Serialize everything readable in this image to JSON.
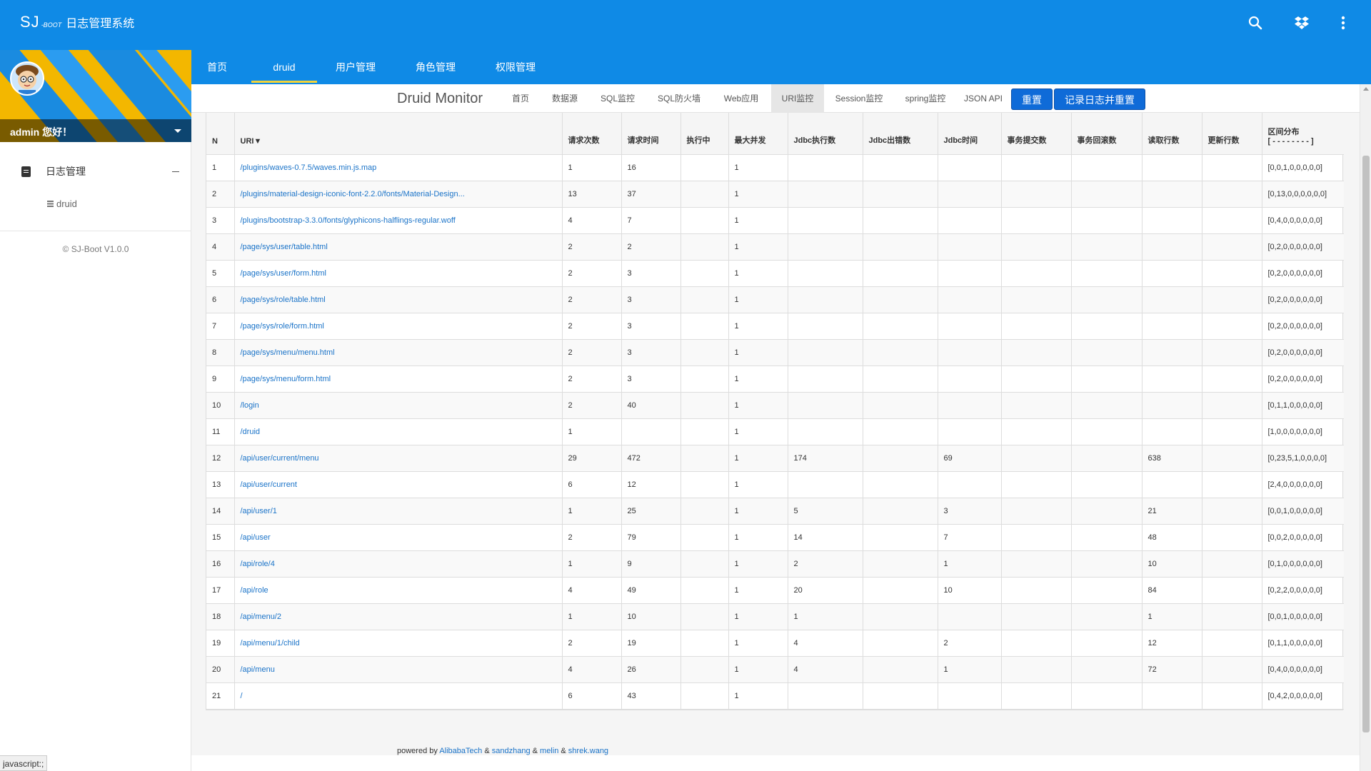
{
  "app": {
    "logo_sj": "SJ",
    "logo_boot": "-BOOT",
    "title": "日志管理系统"
  },
  "top_icons": [
    "search-icon",
    "dropbox-icon",
    "more-vert-icon"
  ],
  "sidebar": {
    "user_greeting": "admin 您好！",
    "menu_group": "日志管理",
    "menu_sub": "druid",
    "copyright": "© SJ-Boot V1.0.0"
  },
  "nav": {
    "tabs": [
      "首页",
      "druid",
      "用户管理",
      "角色管理",
      "权限管理"
    ],
    "active": "druid"
  },
  "druid": {
    "brand": "Druid Monitor",
    "tabs": [
      "首页",
      "数据源",
      "SQL监控",
      "SQL防火墙",
      "Web应用",
      "URI监控",
      "Session监控",
      "spring监控",
      "JSON API"
    ],
    "active_tab": "URI监控",
    "reset_button": "重置",
    "log_reset_button": "记录日志并重置"
  },
  "table": {
    "headers": [
      "N",
      "URI▼",
      "请求次数",
      "请求时间",
      "执行中",
      "最大并发",
      "Jdbc执行数",
      "Jdbc出错数",
      "Jdbc时间",
      "事务提交数",
      "事务回滚数",
      "读取行数",
      "更新行数",
      "区间分布",
      "[ - - - - - - - - ]"
    ],
    "rows": [
      [
        "1",
        "/plugins/waves-0.7.5/waves.min.js.map",
        "1",
        "16",
        "",
        "1",
        "",
        "",
        "",
        "",
        "",
        "",
        "",
        "[0,0,1,0,0,0,0,0]"
      ],
      [
        "2",
        "/plugins/material-design-iconic-font-2.2.0/fonts/Material-Design...",
        "13",
        "37",
        "",
        "1",
        "",
        "",
        "",
        "",
        "",
        "",
        "",
        "[0,13,0,0,0,0,0,0]"
      ],
      [
        "3",
        "/plugins/bootstrap-3.3.0/fonts/glyphicons-halflings-regular.woff",
        "4",
        "7",
        "",
        "1",
        "",
        "",
        "",
        "",
        "",
        "",
        "",
        "[0,4,0,0,0,0,0,0]"
      ],
      [
        "4",
        "/page/sys/user/table.html",
        "2",
        "2",
        "",
        "1",
        "",
        "",
        "",
        "",
        "",
        "",
        "",
        "[0,2,0,0,0,0,0,0]"
      ],
      [
        "5",
        "/page/sys/user/form.html",
        "2",
        "3",
        "",
        "1",
        "",
        "",
        "",
        "",
        "",
        "",
        "",
        "[0,2,0,0,0,0,0,0]"
      ],
      [
        "6",
        "/page/sys/role/table.html",
        "2",
        "3",
        "",
        "1",
        "",
        "",
        "",
        "",
        "",
        "",
        "",
        "[0,2,0,0,0,0,0,0]"
      ],
      [
        "7",
        "/page/sys/role/form.html",
        "2",
        "3",
        "",
        "1",
        "",
        "",
        "",
        "",
        "",
        "",
        "",
        "[0,2,0,0,0,0,0,0]"
      ],
      [
        "8",
        "/page/sys/menu/menu.html",
        "2",
        "3",
        "",
        "1",
        "",
        "",
        "",
        "",
        "",
        "",
        "",
        "[0,2,0,0,0,0,0,0]"
      ],
      [
        "9",
        "/page/sys/menu/form.html",
        "2",
        "3",
        "",
        "1",
        "",
        "",
        "",
        "",
        "",
        "",
        "",
        "[0,2,0,0,0,0,0,0]"
      ],
      [
        "10",
        "/login",
        "2",
        "40",
        "",
        "1",
        "",
        "",
        "",
        "",
        "",
        "",
        "",
        "[0,1,1,0,0,0,0,0]"
      ],
      [
        "11",
        "/druid",
        "1",
        "",
        "",
        "1",
        "",
        "",
        "",
        "",
        "",
        "",
        "",
        "[1,0,0,0,0,0,0,0]"
      ],
      [
        "12",
        "/api/user/current/menu",
        "29",
        "472",
        "",
        "1",
        "174",
        "",
        "69",
        "",
        "",
        "638",
        "",
        "[0,23,5,1,0,0,0,0]"
      ],
      [
        "13",
        "/api/user/current",
        "6",
        "12",
        "",
        "1",
        "",
        "",
        "",
        "",
        "",
        "",
        "",
        "[2,4,0,0,0,0,0,0]"
      ],
      [
        "14",
        "/api/user/1",
        "1",
        "25",
        "",
        "1",
        "5",
        "",
        "3",
        "",
        "",
        "21",
        "",
        "[0,0,1,0,0,0,0,0]"
      ],
      [
        "15",
        "/api/user",
        "2",
        "79",
        "",
        "1",
        "14",
        "",
        "7",
        "",
        "",
        "48",
        "",
        "[0,0,2,0,0,0,0,0]"
      ],
      [
        "16",
        "/api/role/4",
        "1",
        "9",
        "",
        "1",
        "2",
        "",
        "1",
        "",
        "",
        "10",
        "",
        "[0,1,0,0,0,0,0,0]"
      ],
      [
        "17",
        "/api/role",
        "4",
        "49",
        "",
        "1",
        "20",
        "",
        "10",
        "",
        "",
        "84",
        "",
        "[0,2,2,0,0,0,0,0]"
      ],
      [
        "18",
        "/api/menu/2",
        "1",
        "10",
        "",
        "1",
        "1",
        "",
        "",
        "",
        "",
        "1",
        "",
        "[0,0,1,0,0,0,0,0]"
      ],
      [
        "19",
        "/api/menu/1/child",
        "2",
        "19",
        "",
        "1",
        "4",
        "",
        "2",
        "",
        "",
        "12",
        "",
        "[0,1,1,0,0,0,0,0]"
      ],
      [
        "20",
        "/api/menu",
        "4",
        "26",
        "",
        "1",
        "4",
        "",
        "1",
        "",
        "",
        "72",
        "",
        "[0,4,0,0,0,0,0,0]"
      ],
      [
        "21",
        "/",
        "6",
        "43",
        "",
        "1",
        "",
        "",
        "",
        "",
        "",
        "",
        "",
        "[0,4,2,0,0,0,0,0]"
      ]
    ]
  },
  "footer": {
    "prefix": "powered by",
    "links": [
      "AlibabaTech",
      "sandzhang",
      "melin",
      "shrek.wang"
    ],
    "sep": "&"
  },
  "statusbar": "javascript:;"
}
